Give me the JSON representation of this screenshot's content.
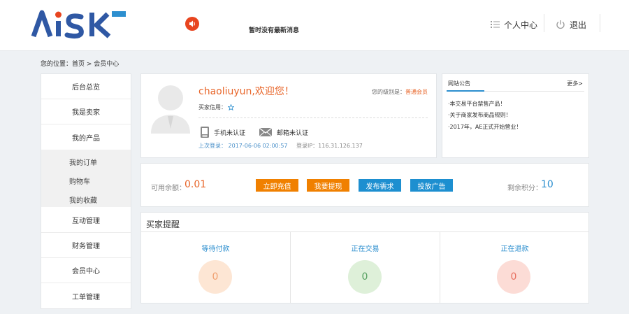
{
  "header": {
    "notice": "暂时没有最新消息",
    "user_center": "个人中心",
    "logout": "退出"
  },
  "breadcrumb": "您的位置：首页 > 会员中心",
  "sidebar": {
    "items": [
      "后台总览",
      "我是卖家",
      "我的产品",
      "互动管理",
      "财务管理",
      "会员中心",
      "工单管理"
    ],
    "sub_items": [
      "我的订单",
      "购物车",
      "我的收藏"
    ]
  },
  "profile": {
    "welcome": "chaoliuyun,欢迎您！",
    "level_label": "您的级别是：",
    "level_value": "普通会员",
    "credit_label": "买家信用：",
    "phone_status": "手机未认证",
    "email_status": "邮箱未认证",
    "last_login": "上次登录：  2017-06-06 02:00:57",
    "login_ip": "登录IP：116.31.126.137"
  },
  "announcements": {
    "title": "网站公告",
    "more": "更多>",
    "items": [
      "·本交易平台禁售产品！",
      "·关于商家发布商品规则！",
      "·2017年，AE正式开始营业！"
    ]
  },
  "balance": {
    "label": "可用余额：",
    "value": "0.01",
    "buttons": [
      "立即充值",
      "我要提现",
      "发布需求",
      "投放广告"
    ],
    "points_label": "剩余积分：",
    "points_value": "10"
  },
  "reminders": {
    "title": "买家提醒",
    "items": [
      {
        "label": "等待付款",
        "count": "0"
      },
      {
        "label": "正在交易",
        "count": "0"
      },
      {
        "label": "正在退款",
        "count": "0"
      }
    ]
  },
  "colors": {
    "orange": "#f08000",
    "blue": "#1d8fd0",
    "accent": "#e8662a"
  }
}
